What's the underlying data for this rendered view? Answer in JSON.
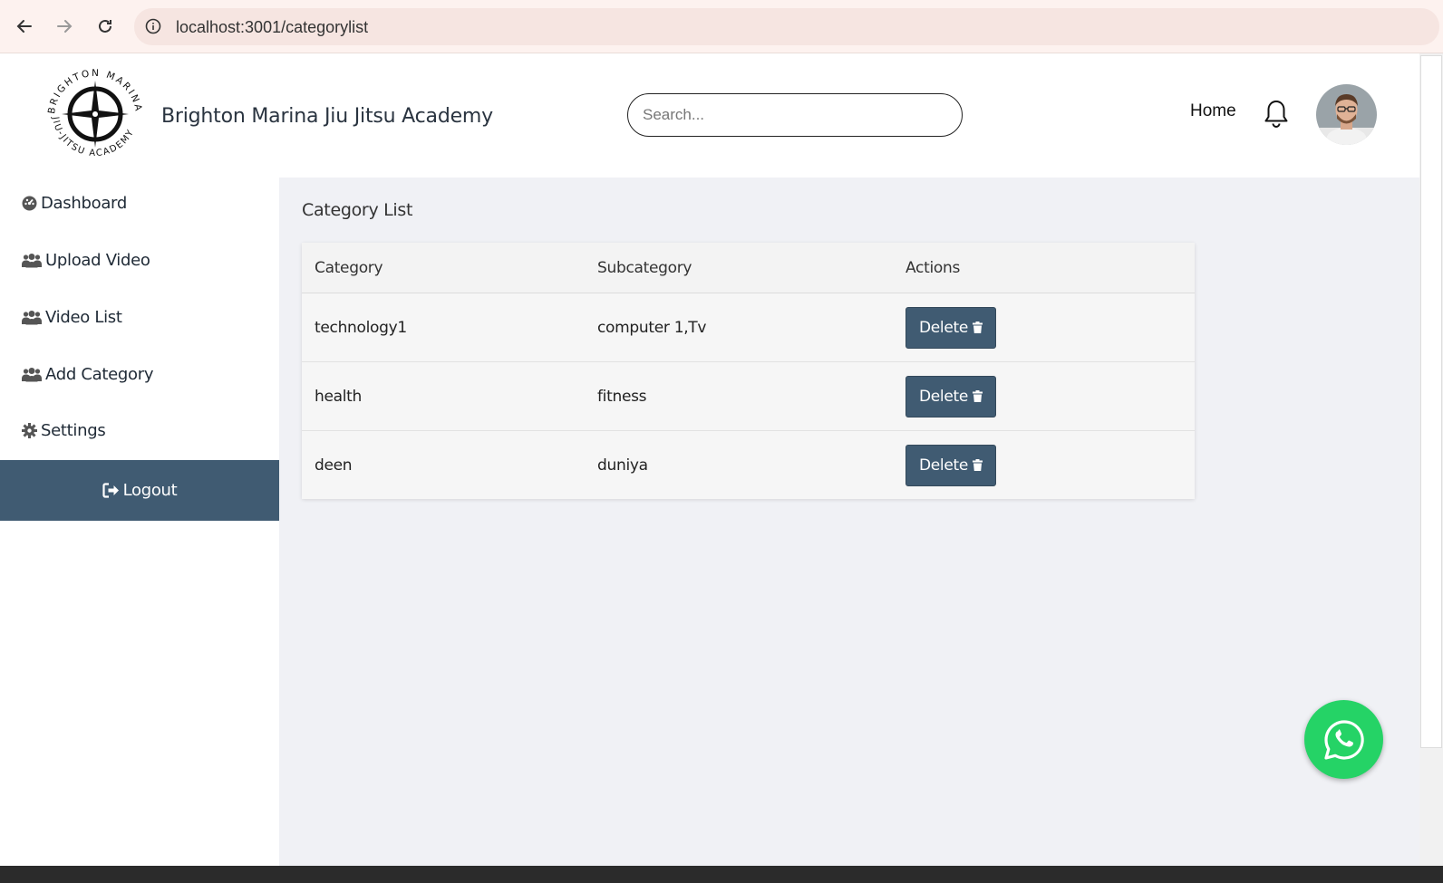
{
  "browser": {
    "url": "localhost:3001/categorylist"
  },
  "header": {
    "logo_text_top": "BRIGHTON MARINA",
    "logo_text_bottom": "JIU-JITSU ACADEMY",
    "brand": "Brighton Marina Jiu Jitsu Academy",
    "search_placeholder": "Search...",
    "home": "Home"
  },
  "sidebar": {
    "items": [
      {
        "label": "Dashboard",
        "icon": "dashboard-icon"
      },
      {
        "label": "Upload Video",
        "icon": "users-icon"
      },
      {
        "label": "Video List",
        "icon": "users-icon"
      },
      {
        "label": "Add Category",
        "icon": "users-icon"
      },
      {
        "label": "Settings",
        "icon": "gear-icon"
      }
    ],
    "logout": "Logout"
  },
  "main": {
    "title": "Category List",
    "columns": [
      "Category",
      "Subcategory",
      "Actions"
    ],
    "rows": [
      {
        "category": "technology1",
        "subcategory": "computer 1,Tv",
        "action": "Delete"
      },
      {
        "category": "health",
        "subcategory": "fitness",
        "action": "Delete"
      },
      {
        "category": "deen",
        "subcategory": "duniya",
        "action": "Delete"
      }
    ]
  },
  "colors": {
    "accent": "#405b72",
    "main_bg": "#f0f1f5",
    "whatsapp": "#25d366"
  }
}
